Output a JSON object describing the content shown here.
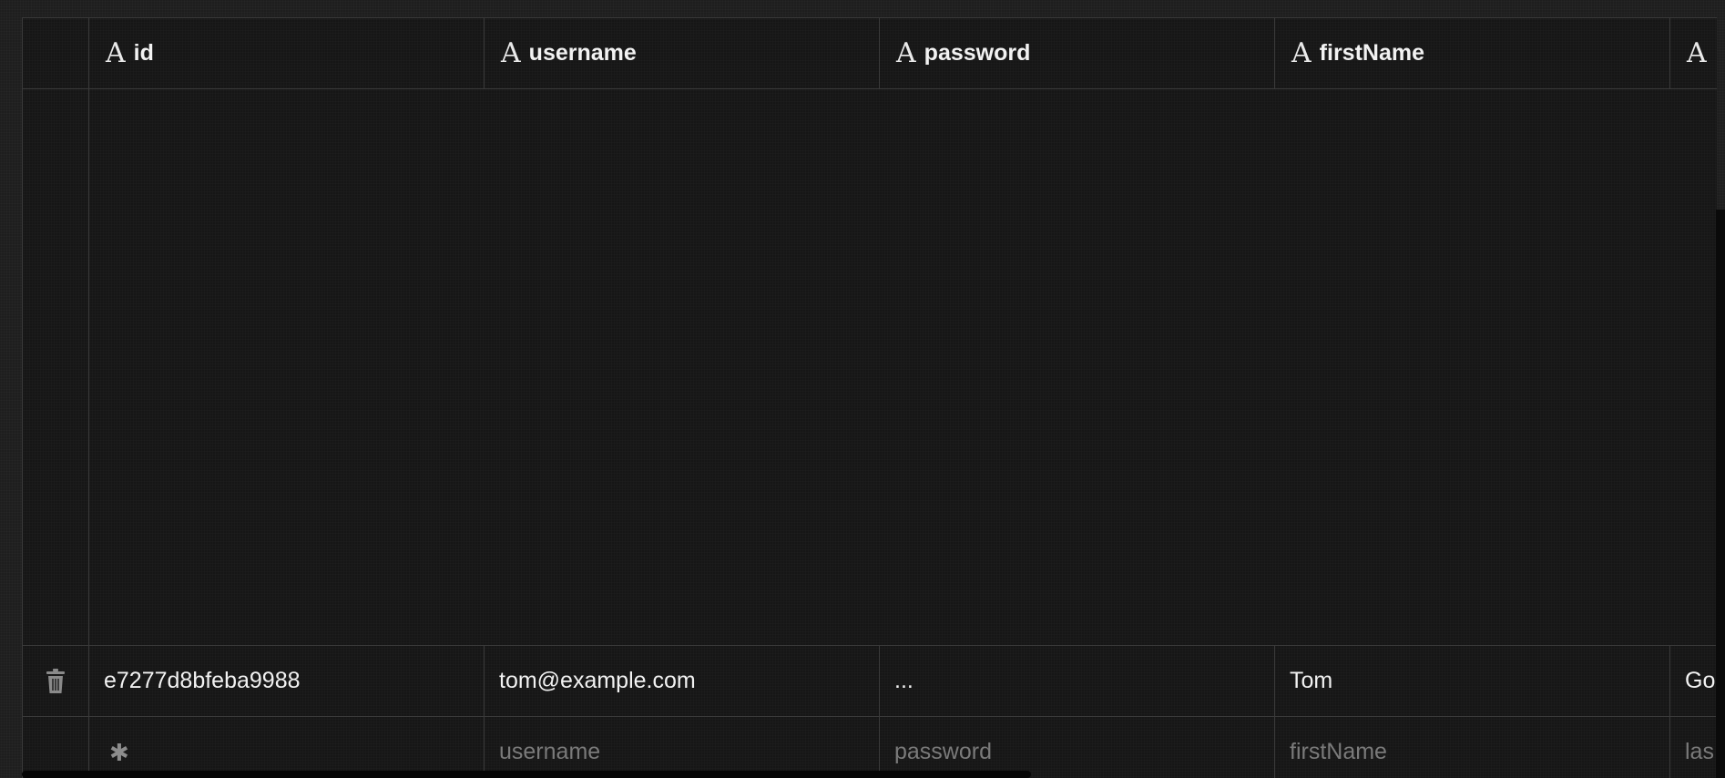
{
  "table": {
    "columns": [
      {
        "type_icon": "A",
        "label": "id"
      },
      {
        "type_icon": "A",
        "label": "username"
      },
      {
        "type_icon": "A",
        "label": "password"
      },
      {
        "type_icon": "A",
        "label": "firstName"
      },
      {
        "type_icon": "A",
        "label": ""
      }
    ],
    "rows": [
      {
        "delete_icon": "trash-icon",
        "cells": [
          "e7277d8bfeba9988",
          "tom@example.com",
          "...",
          "Tom",
          "Go"
        ]
      }
    ],
    "new_row": {
      "marker_icon": "asterisk-icon",
      "marker_glyph": "✱",
      "placeholders": [
        "",
        "username",
        "password",
        "firstName",
        "las"
      ]
    }
  }
}
